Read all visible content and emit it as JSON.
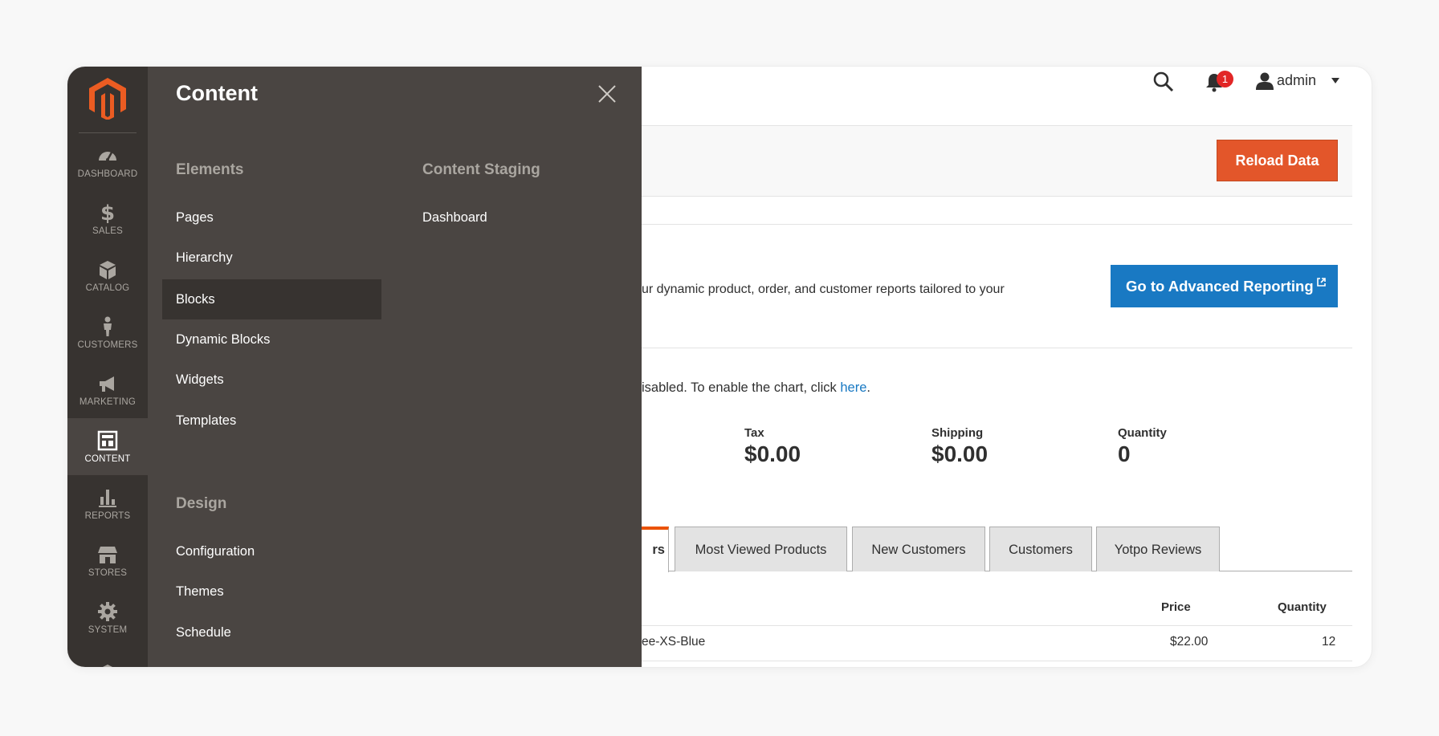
{
  "colors": {
    "nav_bg": "#373330",
    "panel_bg": "#4a4542",
    "brand_orange": "#eb5c22",
    "reload_button": "#e3562a",
    "advanced_button": "#1979c3",
    "link": "#1979c3",
    "notification_badge": "#e22626"
  },
  "nav": {
    "logo": "magento-logo-icon",
    "items": [
      {
        "label": "DASHBOARD",
        "icon": "dashboard-gauge-icon"
      },
      {
        "label": "SALES",
        "icon": "dollar-icon"
      },
      {
        "label": "CATALOG",
        "icon": "box-icon"
      },
      {
        "label": "CUSTOMERS",
        "icon": "person-icon"
      },
      {
        "label": "MARKETING",
        "icon": "megaphone-icon"
      },
      {
        "label": "CONTENT",
        "icon": "layout-icon",
        "active": true
      },
      {
        "label": "REPORTS",
        "icon": "bar-chart-icon"
      },
      {
        "label": "STORES",
        "icon": "storefront-icon"
      },
      {
        "label": "SYSTEM",
        "icon": "gear-icon"
      }
    ]
  },
  "panel": {
    "title": "Content",
    "close_icon": "close-icon",
    "elements": {
      "title": "Elements",
      "links": [
        "Pages",
        "Hierarchy",
        "Blocks",
        "Dynamic Blocks",
        "Widgets",
        "Templates"
      ],
      "active": "Blocks"
    },
    "staging": {
      "title": "Content Staging",
      "links": [
        "Dashboard"
      ]
    },
    "design": {
      "title": "Design",
      "links": [
        "Configuration",
        "Themes",
        "Schedule"
      ]
    }
  },
  "header": {
    "search_icon": "search-icon",
    "bell_icon": "bell-icon",
    "notifications_count": "1",
    "user_icon": "user-icon",
    "username": "admin"
  },
  "page": {
    "reload_button": "Reload Data",
    "advanced_text": "ur dynamic product, order, and customer reports tailored to your",
    "advanced_button": "Go to Advanced Reporting",
    "chart_message": "isabled. To enable the chart, click ",
    "chart_link": "here",
    "chart_message_end": ".",
    "stats": [
      {
        "label": "Tax",
        "value": "$0.00"
      },
      {
        "label": "Shipping",
        "value": "$0.00"
      },
      {
        "label": "Quantity",
        "value": "0"
      }
    ],
    "active_tab_partial": "rs",
    "tabs": [
      "Most Viewed Products",
      "New Customers",
      "Customers",
      "Yotpo Reviews"
    ],
    "table": {
      "headers": [
        "Price",
        "Quantity"
      ],
      "rows": [
        {
          "product": "ee-XS-Blue",
          "price": "$22.00",
          "quantity": "12"
        }
      ]
    }
  }
}
